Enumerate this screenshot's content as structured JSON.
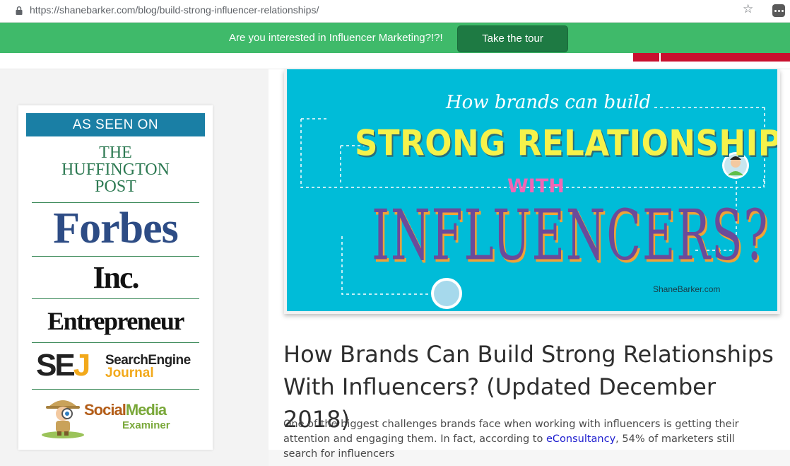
{
  "browser": {
    "url": "https://shanebarker.com/blog/build-strong-influencer-relationships/",
    "lock_icon": "lock-icon",
    "star_icon": "star-icon",
    "extension_icon": "extension-menu-icon"
  },
  "promo": {
    "text": "Are you interested in Influencer Marketing?!?!",
    "button_label": "Take the tour",
    "colors": {
      "bar": "#3fba6a",
      "button": "#1e7a43"
    }
  },
  "sidebar": {
    "heading": "AS SEEN ON",
    "logos": {
      "huffington": "THE HUFFINGTON POST",
      "forbes": "Forbes",
      "inc": "Inc.",
      "entrepreneur": "Entrepreneur",
      "sej_mark": "SEJ",
      "sej_line1": "SearchEngine",
      "sej_line2": "Journal",
      "sme_part1": "Social",
      "sme_part2": "Media",
      "sme_line2": "Examiner"
    }
  },
  "hero": {
    "subtitle": "How brands can build",
    "line1": "STRONG RELATIONSHIPS",
    "with": "WITH",
    "line2": "INFLUENCERS?",
    "brand": "ShaneBarker.com"
  },
  "article": {
    "title": "How Brands Can Build Strong Relationships With Influencers? (Updated December 2018)",
    "body_before_link": "One of the biggest challenges brands face when working with influencers is getting their attention and engaging them. In fact, according to ",
    "link_text": "eConsultancy",
    "body_after_link": ", 54% of marketers still search for influencers"
  }
}
